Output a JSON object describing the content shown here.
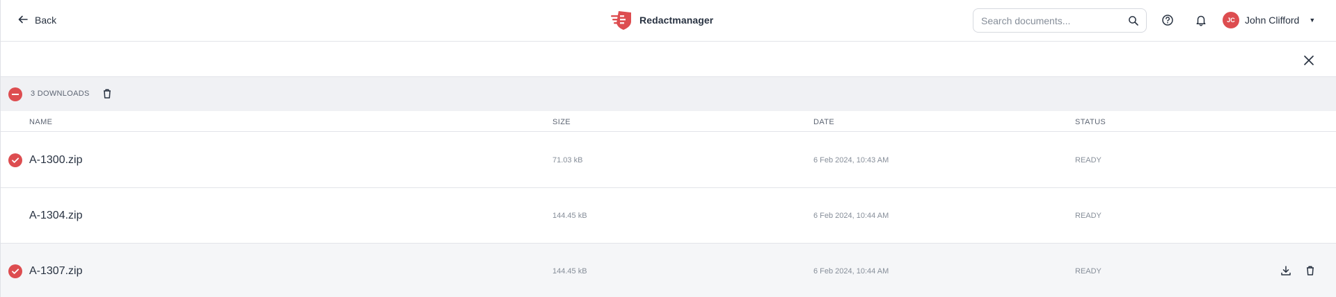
{
  "header": {
    "back_label": "Back",
    "brand_name": "Redactmanager",
    "search_placeholder": "Search documents...",
    "user": {
      "initials": "JC",
      "name": "John Clifford"
    }
  },
  "colors": {
    "accent": "#dd4d50",
    "text": "#283241",
    "muted": "#868e99",
    "bar": "#f0f1f4"
  },
  "bulk": {
    "label": "3 DOWNLOADS"
  },
  "table": {
    "columns": {
      "name": "NAME",
      "size": "SIZE",
      "date": "DATE",
      "status": "STATUS"
    },
    "rows": [
      {
        "name": "A-1300.zip",
        "size": "71.03 kB",
        "date": "6 Feb 2024, 10:43 AM",
        "status": "READY",
        "selected": true
      },
      {
        "name": "A-1304.zip",
        "size": "144.45 kB",
        "date": "6 Feb 2024, 10:44 AM",
        "status": "READY",
        "selected": false
      },
      {
        "name": "A-1307.zip",
        "size": "144.45 kB",
        "date": "6 Feb 2024, 10:44 AM",
        "status": "READY",
        "selected": true
      }
    ]
  },
  "icons": {
    "back": "arrow-left-icon",
    "brand": "shield-logo-icon",
    "search": "search-icon",
    "help": "help-circle-icon",
    "notifications": "bell-icon",
    "close": "close-icon",
    "trash": "trash-icon",
    "download": "download-icon",
    "check": "check-icon"
  }
}
